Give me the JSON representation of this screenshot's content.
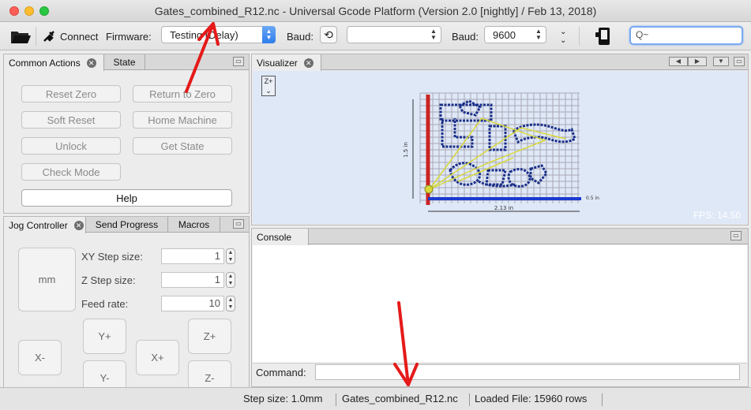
{
  "window": {
    "title": "Gates_combined_R12.nc - Universal Gcode Platform (Version 2.0 [nightly]  / Feb 13, 2018)"
  },
  "toolbar": {
    "connect_label": "Connect",
    "firmware_label": "Firmware:",
    "firmware_value": "Testing (Delay)",
    "baud_label_1": "Baud:",
    "port_value": "",
    "baud_label_2": "Baud:",
    "baud_value": "9600",
    "search_placeholder": "Q~"
  },
  "common_actions": {
    "tabs": [
      "Common Actions",
      "State"
    ],
    "buttons": {
      "reset_zero": "Reset Zero",
      "return_to_zero": "Return to Zero",
      "soft_reset": "Soft Reset",
      "home_machine": "Home Machine",
      "unlock": "Unlock",
      "get_state": "Get State",
      "check_mode": "Check Mode",
      "help": "Help"
    }
  },
  "jog": {
    "tabs": [
      "Jog Controller",
      "Send Progress",
      "Macros"
    ],
    "units": "mm",
    "xy_step_label": "XY Step size:",
    "xy_step_value": "1",
    "z_step_label": "Z Step size:",
    "z_step_value": "1",
    "feed_label": "Feed rate:",
    "feed_value": "10",
    "buttons": {
      "x_minus": "X-",
      "x_plus": "X+",
      "y_plus": "Y+",
      "y_minus": "Y-",
      "z_plus": "Z+",
      "z_minus": "Z-"
    }
  },
  "visualizer": {
    "tab": "Visualizer",
    "z_toggle": "Z+",
    "dim_vertical": "1.5 in",
    "dim_horizontal": "2.13 in",
    "dim_small": "0.5 in",
    "fps": "FPS: 14.50"
  },
  "console": {
    "tab": "Console",
    "command_label": "Command:",
    "command_value": ""
  },
  "status": {
    "step_size": "Step size: 1.0mm",
    "file": "Gates_combined_R12.nc",
    "loaded": "Loaded File: 15960 rows"
  },
  "colors": {
    "annotation_arrow": "#e51a1a",
    "visualizer_bg": "#dfe8f7",
    "toolpath": "#1b2f8a",
    "rapid_path": "#d8d83a",
    "x_axis": "#1a3ad0",
    "y_axis": "#cc2222"
  }
}
